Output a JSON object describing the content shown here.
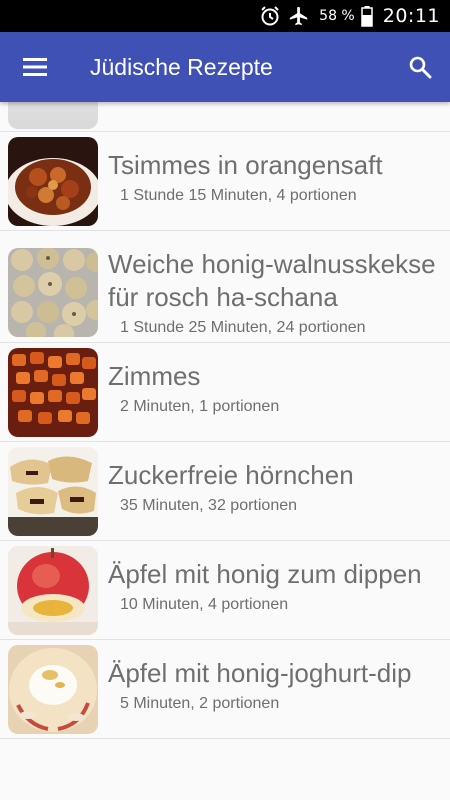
{
  "status_bar": {
    "icons": [
      "alarm-icon",
      "airplane-mode-icon",
      "battery-icon"
    ],
    "battery_percent": "58 %",
    "time": "20:11"
  },
  "app_bar": {
    "title": "Jüdische Rezepte",
    "background_color": "#3f51b5",
    "menu_icon": "hamburger-menu-icon",
    "search_icon": "search-icon"
  },
  "recipes": [
    {
      "title": "Tsimmes in orangensaft",
      "meta": "1 Stunde 15 Minuten, 4 portionen",
      "image": "tsimmes-photo"
    },
    {
      "title": "Weiche honig-walnusskekse für rosch ha-schana",
      "meta": "1 Stunde 25 Minuten, 24 portionen",
      "image": "cookies-photo"
    },
    {
      "title": "Zimmes",
      "meta": "2 Minuten, 1 portionen",
      "image": "carrots-photo"
    },
    {
      "title": "Zuckerfreie hörnchen",
      "meta": "35 Minuten, 32 portionen",
      "image": "rugelach-photo"
    },
    {
      "title": "Äpfel mit honig zum dippen",
      "meta": "10 Minuten, 4 portionen",
      "image": "apple-honey-photo"
    },
    {
      "title": "Äpfel mit honig-joghurt-dip",
      "meta": "5 Minuten, 2 portionen",
      "image": "apple-yogurt-photo"
    }
  ]
}
